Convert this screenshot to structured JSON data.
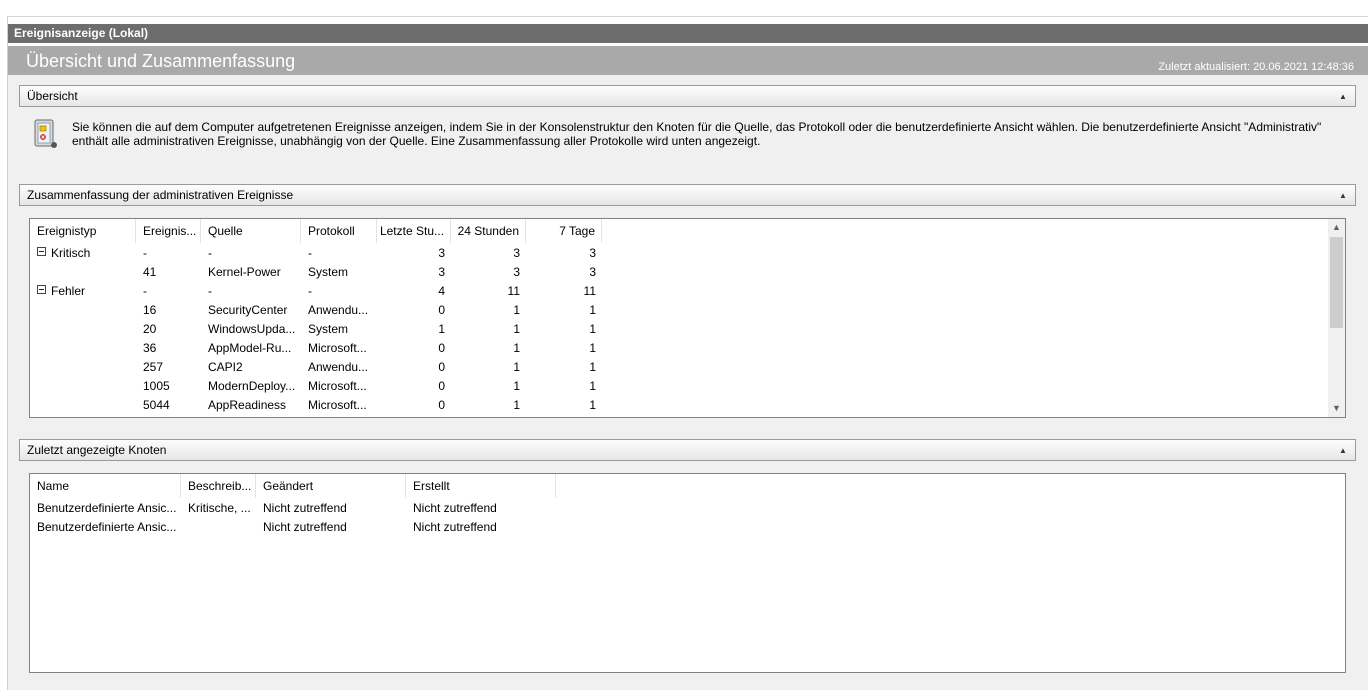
{
  "console_title": "Ereignisanzeige (Lokal)",
  "header": {
    "title": "Übersicht und Zusammenfassung",
    "last_updated": "Zuletzt aktualisiert: 20.06.2021 12:48:36"
  },
  "overview": {
    "title": "Übersicht",
    "text_line1": "Sie können die auf dem Computer aufgetretenen Ereignisse anzeigen, indem Sie in der Konsolenstruktur den Knoten für die Quelle, das Protokoll oder die benutzerdefinierte Ansicht wählen. Die benutzerdefinierte Ansicht \"Administrativ\"",
    "text_line2": "enthält alle administrativen Ereignisse, unabhängig von der Quelle. Eine Zusammenfassung aller Protokolle wird unten angezeigt.",
    "icon": "event-log-icon"
  },
  "summary": {
    "title": "Zusammenfassung der administrativen Ereignisse",
    "columns": [
      "Ereignistyp",
      "Ereignis...",
      "Quelle",
      "Protokoll",
      "Letzte Stu...",
      "24 Stunden",
      "7 Tage"
    ],
    "rows": [
      {
        "type": "Kritisch",
        "expander": true,
        "id": "-",
        "source": "-",
        "log": "-",
        "last_hour": "3",
        "h24": "3",
        "d7": "3"
      },
      {
        "type": "",
        "expander": false,
        "id": "41",
        "source": "Kernel-Power",
        "log": "System",
        "last_hour": "3",
        "h24": "3",
        "d7": "3"
      },
      {
        "type": "Fehler",
        "expander": true,
        "id": "-",
        "source": "-",
        "log": "-",
        "last_hour": "4",
        "h24": "11",
        "d7": "11"
      },
      {
        "type": "",
        "expander": false,
        "id": "16",
        "source": "SecurityCenter",
        "log": "Anwendu...",
        "last_hour": "0",
        "h24": "1",
        "d7": "1"
      },
      {
        "type": "",
        "expander": false,
        "id": "20",
        "source": "WindowsUpda...",
        "log": "System",
        "last_hour": "1",
        "h24": "1",
        "d7": "1"
      },
      {
        "type": "",
        "expander": false,
        "id": "36",
        "source": "AppModel-Ru...",
        "log": "Microsoft...",
        "last_hour": "0",
        "h24": "1",
        "d7": "1"
      },
      {
        "type": "",
        "expander": false,
        "id": "257",
        "source": "CAPI2",
        "log": "Anwendu...",
        "last_hour": "0",
        "h24": "1",
        "d7": "1"
      },
      {
        "type": "",
        "expander": false,
        "id": "1005",
        "source": "ModernDeploy...",
        "log": "Microsoft...",
        "last_hour": "0",
        "h24": "1",
        "d7": "1"
      },
      {
        "type": "",
        "expander": false,
        "id": "5044",
        "source": "AppReadiness",
        "log": "Microsoft...",
        "last_hour": "0",
        "h24": "1",
        "d7": "1"
      }
    ]
  },
  "recent": {
    "title": "Zuletzt angezeigte Knoten",
    "columns": [
      "Name",
      "Beschreib...",
      "Geändert",
      "Erstellt"
    ],
    "rows": [
      {
        "name": "Benutzerdefinierte Ansic...",
        "desc": "Kritische, ...",
        "changed": "Nicht zutreffend",
        "created": "Nicht zutreffend"
      },
      {
        "name": "Benutzerdefinierte Ansic...",
        "desc": "",
        "changed": "Nicht zutreffend",
        "created": "Nicht zutreffend"
      }
    ]
  }
}
